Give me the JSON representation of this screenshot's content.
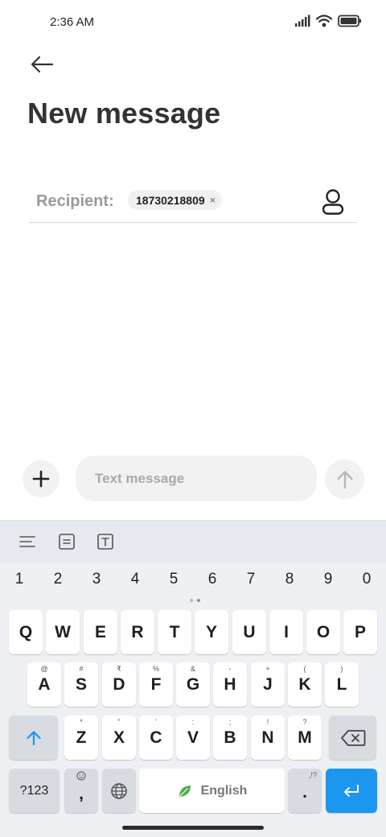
{
  "status_bar": {
    "time": "2:36 AM",
    "signal_icon": "signal-bars-icon",
    "wifi_icon": "wifi-icon",
    "battery_icon": "battery-icon"
  },
  "header": {
    "back_icon": "back-arrow-icon",
    "title": "New message"
  },
  "recipient": {
    "label": "Recipient:",
    "chip": "18730218809",
    "chip_remove": "×",
    "contact_icon": "contact-person-icon"
  },
  "compose": {
    "add_icon": "plus-icon",
    "placeholder": "Text message",
    "value": "",
    "send_icon": "send-arrow-up-icon"
  },
  "keyboard": {
    "toolbar_icons": [
      "menu-lines-icon",
      "clipboard-icon",
      "text-format-icon"
    ],
    "number_row": [
      "1",
      "2",
      "3",
      "4",
      "5",
      "6",
      "7",
      "8",
      "9",
      "0"
    ],
    "row1": [
      "Q",
      "W",
      "E",
      "R",
      "T",
      "Y",
      "U",
      "I",
      "O",
      "P"
    ],
    "row2": [
      {
        "key": "A",
        "hint": "@"
      },
      {
        "key": "S",
        "hint": "#"
      },
      {
        "key": "D",
        "hint": "₹"
      },
      {
        "key": "F",
        "hint": "%"
      },
      {
        "key": "G",
        "hint": "&"
      },
      {
        "key": "H",
        "hint": "-"
      },
      {
        "key": "J",
        "hint": "+"
      },
      {
        "key": "K",
        "hint": "("
      },
      {
        "key": "L",
        "hint": ")"
      }
    ],
    "row3": [
      {
        "key": "Z",
        "hint": "*"
      },
      {
        "key": "X",
        "hint": "\""
      },
      {
        "key": "C",
        "hint": "'"
      },
      {
        "key": "V",
        "hint": ":"
      },
      {
        "key": "B",
        "hint": ";"
      },
      {
        "key": "N",
        "hint": "!"
      },
      {
        "key": "M",
        "hint": "?"
      }
    ],
    "symbols_key": "?123",
    "comma_key": ",",
    "space_label": "English",
    "period_key": ".",
    "period_hint": ",!?",
    "shift_icon": "shift-arrow-icon",
    "backspace_icon": "backspace-icon",
    "emoji_icon": "emoji-icon",
    "globe_icon": "globe-icon",
    "language_icon": "leaf-icon",
    "enter_icon": "enter-return-icon",
    "colors": {
      "enter": "#1c97f0",
      "shift": "#1c97f0",
      "leaf": "#4caf50"
    }
  }
}
